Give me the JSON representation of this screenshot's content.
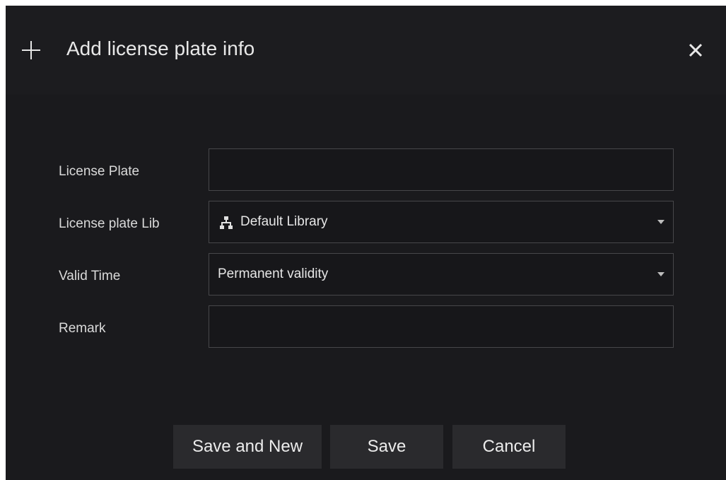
{
  "dialog": {
    "title": "Add license plate info",
    "icons": {
      "add": "plus-icon",
      "close": "close-icon",
      "library": "tree-icon",
      "dropdown": "caret-down-icon"
    }
  },
  "form": {
    "license_plate": {
      "label": "License Plate",
      "value": ""
    },
    "license_plate_lib": {
      "label": "License plate Lib",
      "value": "Default Library"
    },
    "valid_time": {
      "label": "Valid Time",
      "value": "Permanent validity"
    },
    "remark": {
      "label": "Remark",
      "value": ""
    }
  },
  "buttons": {
    "save_and_new": "Save and New",
    "save": "Save",
    "cancel": "Cancel"
  },
  "colors": {
    "background": "#1a1a1d",
    "field_border": "#47474a",
    "button": "#2a2a2d"
  }
}
